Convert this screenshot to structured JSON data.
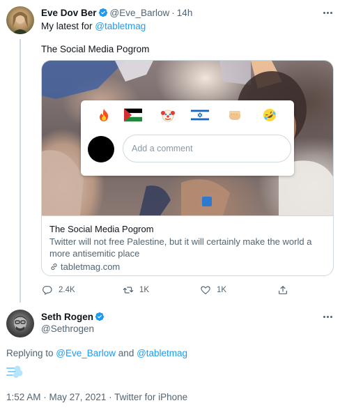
{
  "tweet1": {
    "author_name": "Eve Dov Ber",
    "handle": "@Eve_Barlow",
    "separator": "·",
    "time": "14h",
    "text_prefix": "My latest for ",
    "text_mention": "@tabletmag",
    "headline": "The Social Media Pogrom",
    "card": {
      "overlay_placeholder": "Add a comment",
      "reactions": [
        "fire",
        "palestine-flag",
        "clown",
        "israel-flag",
        "fist",
        "rofl"
      ],
      "title": "The Social Media Pogrom",
      "description": "Twitter will not free Palestine, but it will certainly make the world a more antisemitic place",
      "domain": "tabletmag.com"
    },
    "actions": {
      "replies": "2.4K",
      "retweets": "1K",
      "likes": "1K"
    }
  },
  "tweet2": {
    "author_name": "Seth Rogen",
    "handle": "@Sethrogen",
    "replying_prefix": "Replying to ",
    "replying_user1": "@Eve_Barlow",
    "replying_and": " and ",
    "replying_user2": "@tabletmag",
    "emoji": "dashing-away",
    "footer": "1:52 AM · May 27, 2021 · Twitter for iPhone"
  },
  "colors": {
    "accent": "#1d9bf0",
    "text": "#0f1419",
    "secondary": "#536471",
    "border": "#cfd9de"
  }
}
